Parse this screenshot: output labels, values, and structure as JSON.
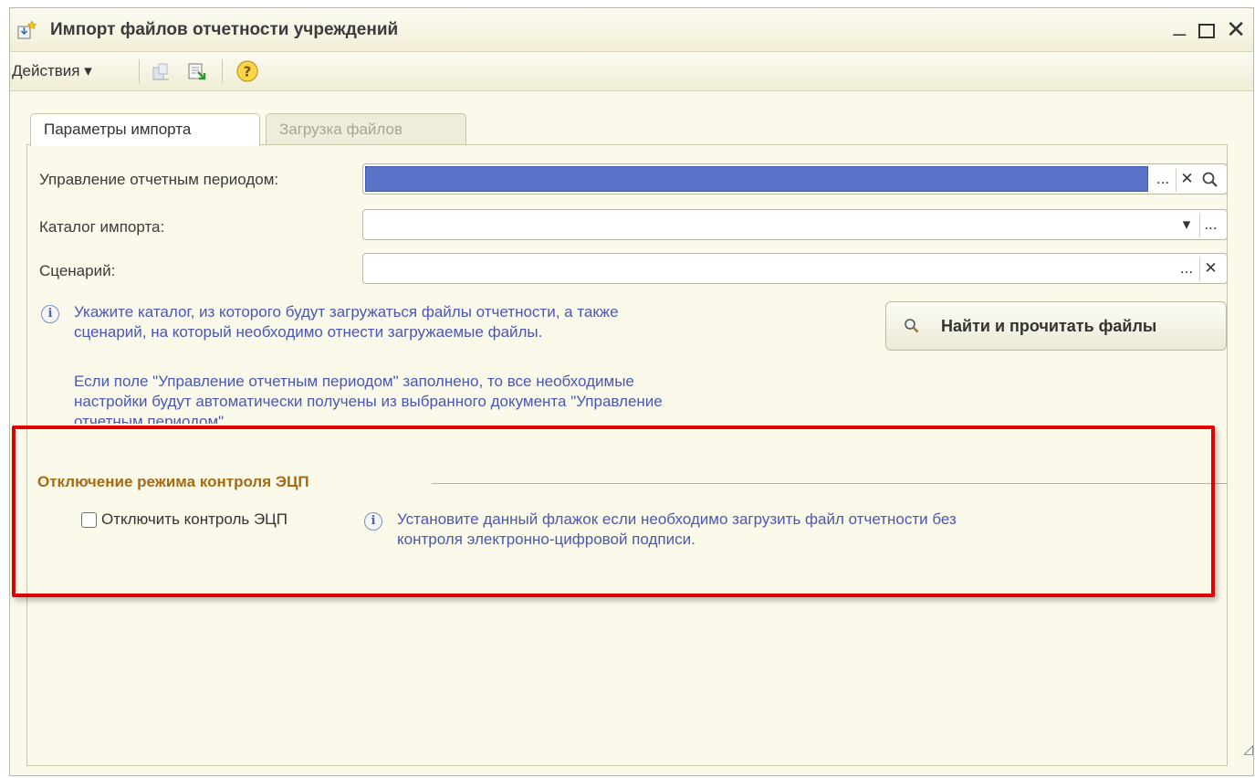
{
  "window": {
    "title": "Импорт файлов отчетности учреждений",
    "min_glyph": "_",
    "close_glyph": "✕"
  },
  "toolbar": {
    "actions_label": "Действия ▾"
  },
  "tabs": [
    {
      "label": "Параметры импорта",
      "active": true
    },
    {
      "label": "Загрузка файлов",
      "active": false
    }
  ],
  "form": {
    "period": {
      "label": "Управление отчетным периодом:",
      "value": ""
    },
    "catalog": {
      "label": "Каталог импорта:",
      "value": ""
    },
    "scenario": {
      "label": "Сценарий:",
      "value": ""
    }
  },
  "buttons": {
    "ellipsis": "...",
    "clear": "✕",
    "search": "🔍",
    "dropdown": "▾"
  },
  "info": {
    "line1": "Укажите каталог, из которого будут загружаться файлы отчетности, а также",
    "line2": "сценарий, на который необходимо отнести загружаемые файлы.",
    "line3": "Если поле \"Управление отчетным периодом\" заполнено, то все необходимые",
    "line4": "настройки будут автоматически получены из выбранного документа \"Управление",
    "line5": "отчетным периодом\"."
  },
  "find_button": {
    "label": "Найти и прочитать файлы"
  },
  "ecp_group": {
    "title": "Отключение режима контроля ЭЦП",
    "checkbox_label": "Отключить контроль ЭЦП",
    "checked": false,
    "hint_line1": "Установите данный флажок если необходимо загрузить файл отчетности без",
    "hint_line2": "контроля электронно-цифровой подписи."
  },
  "colors": {
    "panel_bg": "#fbf9ea",
    "selection_blue": "#5b72c9",
    "info_text": "#4857b8",
    "group_title": "#a56a12",
    "highlight_red": "#e00000"
  }
}
